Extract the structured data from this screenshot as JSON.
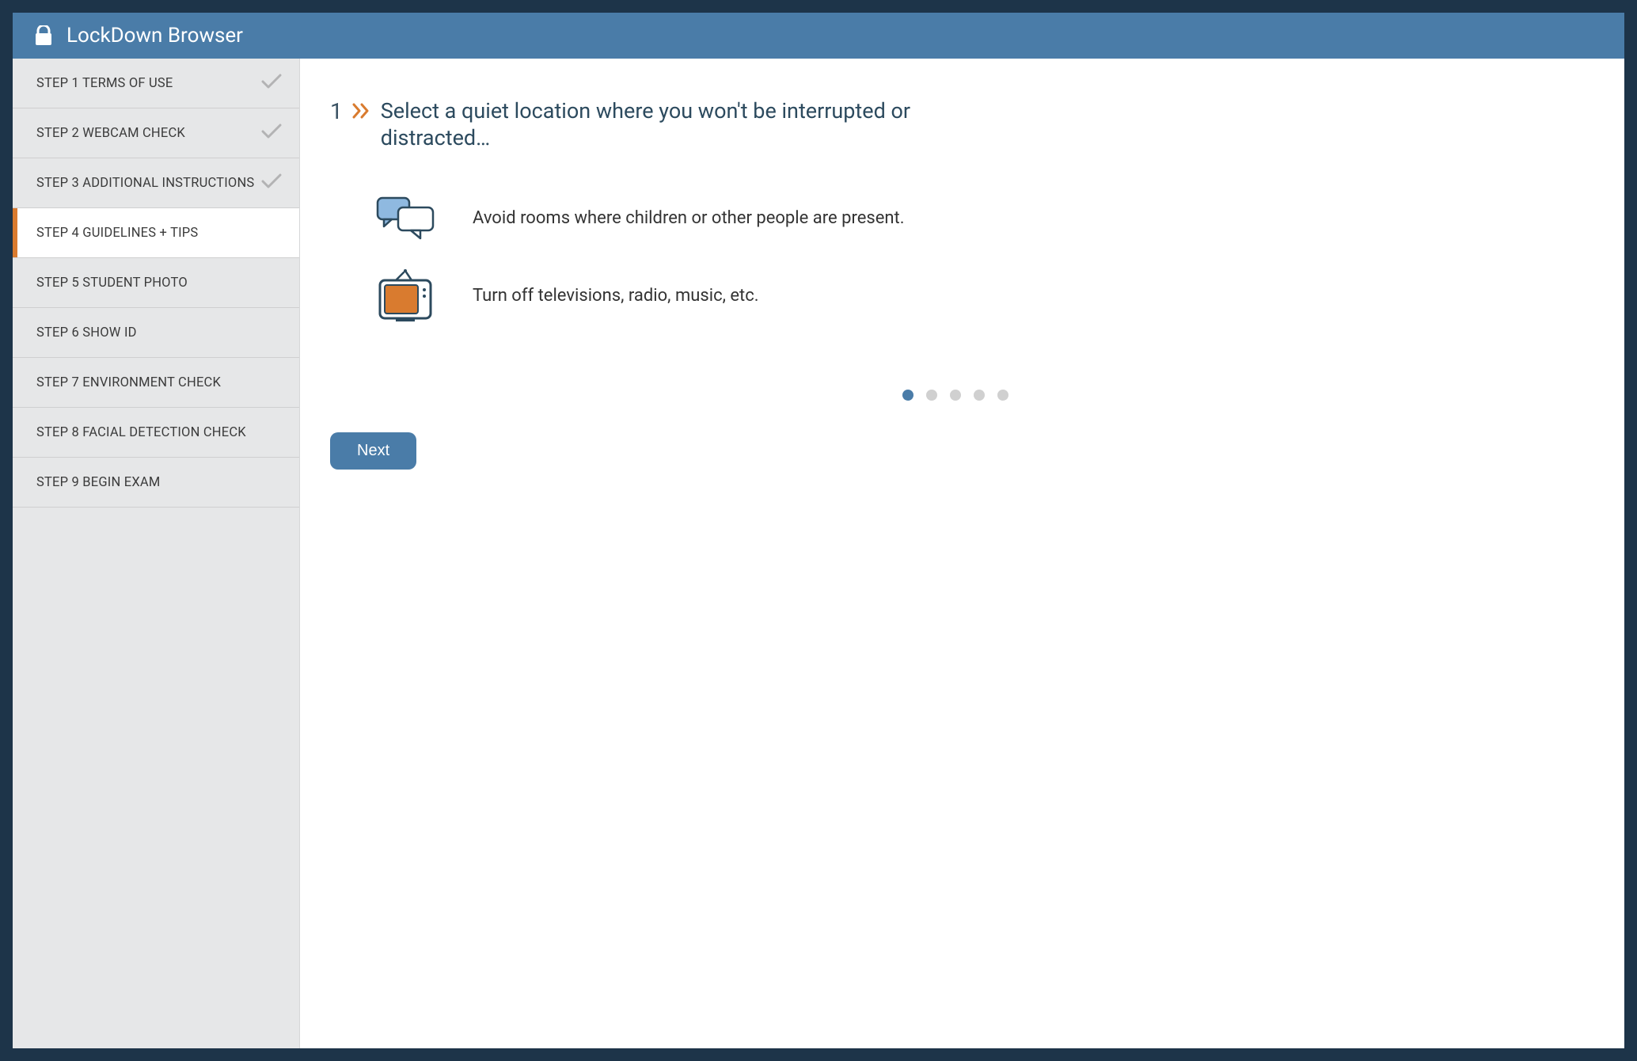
{
  "app": {
    "title": "LockDown Browser"
  },
  "sidebar": {
    "steps": [
      {
        "label": "STEP 1 TERMS OF USE",
        "completed": true,
        "active": false
      },
      {
        "label": "STEP 2 WEBCAM CHECK",
        "completed": true,
        "active": false
      },
      {
        "label": "STEP 3 ADDITIONAL INSTRUCTIONS",
        "completed": true,
        "active": false
      },
      {
        "label": "STEP 4 GUIDELINES + TIPS",
        "completed": false,
        "active": true
      },
      {
        "label": "STEP 5 STUDENT PHOTO",
        "completed": false,
        "active": false
      },
      {
        "label": "STEP 6 SHOW ID",
        "completed": false,
        "active": false
      },
      {
        "label": "STEP 7 ENVIRONMENT CHECK",
        "completed": false,
        "active": false
      },
      {
        "label": "STEP 8 FACIAL DETECTION CHECK",
        "completed": false,
        "active": false
      },
      {
        "label": "STEP 9 BEGIN EXAM",
        "completed": false,
        "active": false
      }
    ]
  },
  "content": {
    "page_number": "1",
    "heading": "Select a quiet location where you won't be interrupted or distracted…",
    "tips": [
      {
        "icon": "speech-bubbles-icon",
        "text": "Avoid rooms where children or other people are present."
      },
      {
        "icon": "tv-icon",
        "text": "Turn off televisions, radio, music, etc."
      }
    ],
    "pager": {
      "total": 5,
      "active_index": 0
    },
    "next_label": "Next"
  },
  "colors": {
    "accent_blue": "#4a7ca8",
    "accent_orange": "#d97b2f",
    "frame_navy": "#1d3449"
  }
}
